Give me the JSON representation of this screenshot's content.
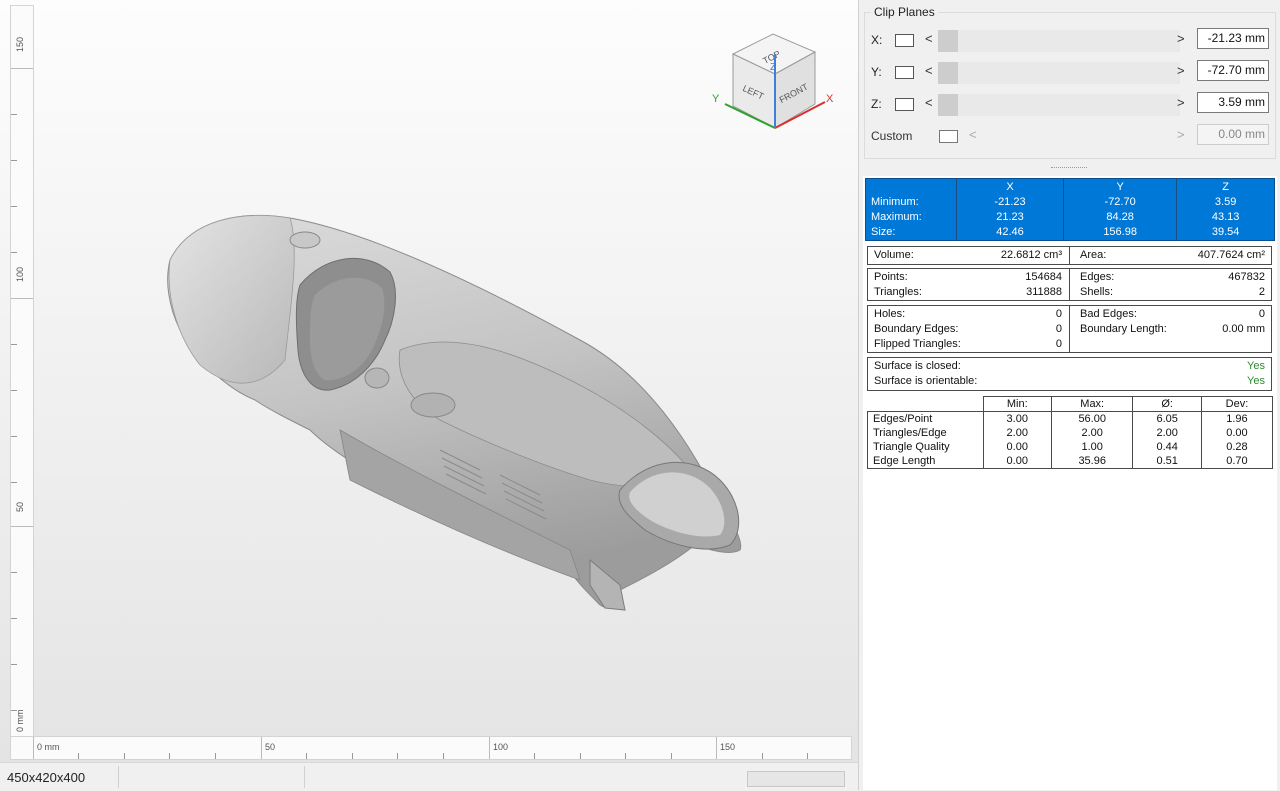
{
  "viewport": {
    "ruler_v_labels": [
      "150",
      "100",
      "50",
      "0 mm"
    ],
    "ruler_h_labels": [
      "0 mm",
      "50",
      "100",
      "150"
    ],
    "navcube": {
      "top": "TOP",
      "left": "LEFT",
      "front": "FRONT",
      "axis_x": "X",
      "axis_y": "Y",
      "axis_z": "Z"
    }
  },
  "status_bar": {
    "dimensions": "450x420x400"
  },
  "clip_planes": {
    "title": "Clip Planes",
    "rows": [
      {
        "label": "X:",
        "value": "-21.23 mm"
      },
      {
        "label": "Y:",
        "value": "-72.70 mm"
      },
      {
        "label": "Z:",
        "value": "3.59 mm"
      },
      {
        "label": "Custom",
        "value": "0.00 mm"
      }
    ],
    "arrow_left": "<",
    "arrow_right": ">"
  },
  "bounding_box": {
    "headers": [
      "",
      "X",
      "Y",
      "Z"
    ],
    "rows": [
      {
        "label": "Minimum:",
        "x": "-21.23",
        "y": "-72.70",
        "z": "3.59"
      },
      {
        "label": "Maximum:",
        "x": "21.23",
        "y": "84.28",
        "z": "43.13"
      },
      {
        "label": "Size:",
        "x": "42.46",
        "y": "156.98",
        "z": "39.54"
      }
    ]
  },
  "volume_area": {
    "volume_label": "Volume:",
    "volume": "22.6812 cm³",
    "area_label": "Area:",
    "area": "407.7624 cm²"
  },
  "counts": {
    "points_label": "Points:",
    "points": "154684",
    "triangles_label": "Triangles:",
    "triangles": "311888",
    "edges_label": "Edges:",
    "edges": "467832",
    "shells_label": "Shells:",
    "shells": "2"
  },
  "errors": {
    "holes_label": "Holes:",
    "holes": "0",
    "boundary_edges_label": "Boundary Edges:",
    "boundary_edges": "0",
    "flipped_label": "Flipped Triangles:",
    "flipped": "0",
    "bad_edges_label": "Bad Edges:",
    "bad_edges": "0",
    "boundary_length_label": "Boundary Length:",
    "boundary_length": "0.00 mm"
  },
  "surface": {
    "closed_label": "Surface is closed:",
    "closed": "Yes",
    "orientable_label": "Surface is orientable:",
    "orientable": "Yes"
  },
  "stats": {
    "headers": [
      "Min:",
      "Max:",
      "Ø:",
      "Dev:"
    ],
    "rows": [
      {
        "label": "Edges/Point",
        "min": "3.00",
        "max": "56.00",
        "avg": "6.05",
        "dev": "1.96"
      },
      {
        "label": "Triangles/Edge",
        "min": "2.00",
        "max": "2.00",
        "avg": "2.00",
        "dev": "0.00"
      },
      {
        "label": "Triangle Quality",
        "min": "0.00",
        "max": "1.00",
        "avg": "0.44",
        "dev": "0.28"
      },
      {
        "label": "Edge Length",
        "min": "0.00",
        "max": "35.96",
        "avg": "0.51",
        "dev": "0.70"
      }
    ]
  }
}
